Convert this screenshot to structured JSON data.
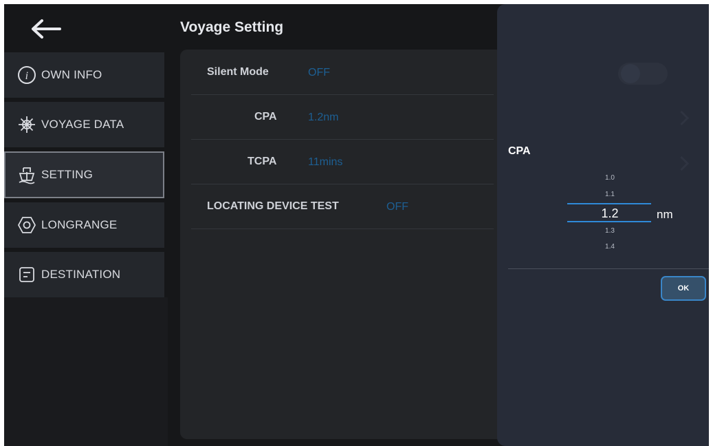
{
  "header": {
    "title": "Voyage Setting"
  },
  "sidebar": {
    "items": [
      {
        "label": "OWN INFO",
        "icon": "info-icon",
        "active": false
      },
      {
        "label": "VOYAGE DATA",
        "icon": "ship-wheel-icon",
        "active": false
      },
      {
        "label": "SETTING",
        "icon": "ship-icon",
        "active": true
      },
      {
        "label": "LONGRANGE",
        "icon": "hexagon-target-icon",
        "active": false
      },
      {
        "label": "DESTINATION",
        "icon": "document-icon",
        "active": false
      }
    ]
  },
  "settings": {
    "rows": [
      {
        "label": "Silent Mode",
        "value": "OFF"
      },
      {
        "label": "CPA",
        "value": "1.2nm"
      },
      {
        "label": "TCPA",
        "value": "11mins"
      },
      {
        "label": "LOCATING DEVICE TEST",
        "value": "OFF"
      }
    ]
  },
  "dialog": {
    "title": "CPA",
    "options_above": [
      "1.0",
      "1.1"
    ],
    "current": "1.2",
    "options_below": [
      "1.3",
      "1.4"
    ],
    "unit": "nm",
    "ok_label": "OK"
  },
  "colors": {
    "background": "#161719",
    "panel": "#232528",
    "dialog": "#272c38",
    "value_text": "#1d5f93",
    "accent": "#2f8ad8"
  }
}
